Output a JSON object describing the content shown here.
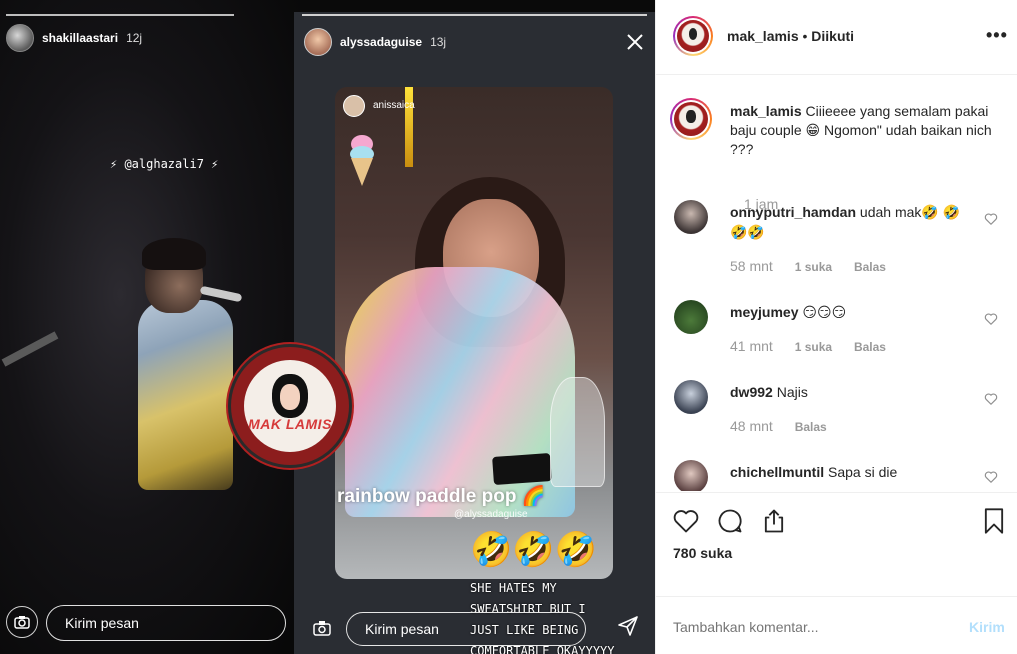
{
  "stories": {
    "left": {
      "username": "shakillaastari",
      "time": "12j",
      "mention": "⚡ @alghazali7 ⚡",
      "message_placeholder": "Kirim pesan"
    },
    "right": {
      "username": "alyssadaguise",
      "time": "13j",
      "inner_username": "anissaica",
      "sticker_text": "rainbow paddle pop 🌈",
      "sticker_tag": "@alyssadaguise",
      "emojis": "🤣🤣🤣",
      "caption": "SHE HATES MY SWEATSHIRT BUT I JUST LIKE BEING COMFORTABLE OKAYYYYY",
      "message_placeholder": "Kirim pesan"
    },
    "watermark_text": "MAK LAMIS"
  },
  "post": {
    "author": "mak_lamis",
    "separator": "•",
    "follow_status": "Diikuti",
    "more_label": "•••",
    "caption_user": "mak_lamis",
    "caption_text": "Ciiieeee yang semalam pakai baju couple 😁 Ngomon\" udah baikan nich ???",
    "caption_time": "1 jam",
    "comments": [
      {
        "user": "onnyputri_hamdan",
        "text": "udah mak🤣 🤣🤣🤣",
        "time": "58 mnt",
        "likes": "1 suka",
        "reply": "Balas"
      },
      {
        "user": "meyjumey",
        "text": "😏😏😏",
        "time": "41 mnt",
        "likes": "1 suka",
        "reply": "Balas"
      },
      {
        "user": "dw992",
        "text": "Najis",
        "time": "48 mnt",
        "reply": "Balas"
      },
      {
        "user": "chichellmuntil",
        "text": "Sapa si die"
      }
    ],
    "likes_count": "780 suka",
    "add_comment_placeholder": "Tambahkan komentar...",
    "post_button": "Kirim"
  },
  "colors": {
    "text": "#262626",
    "muted": "#999999",
    "post_button_disabled": "#b2dffc",
    "border": "#efefef"
  }
}
